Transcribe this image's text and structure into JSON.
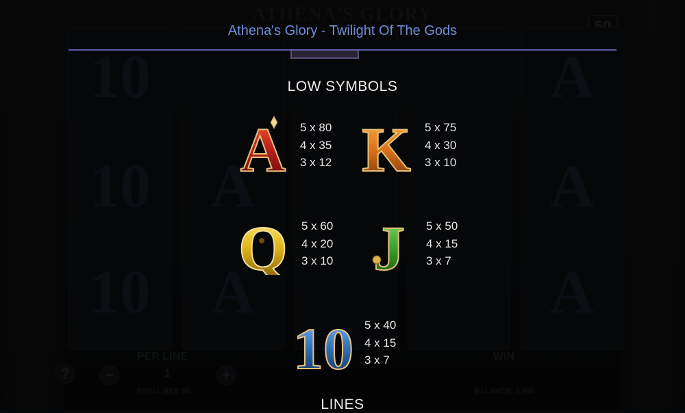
{
  "background": {
    "game_title": "ATHENA'S GLORY",
    "corner_value": "50",
    "per_line_label": "PER LINE",
    "per_line_value": "1",
    "win_label": "WIN",
    "total_bet_label": "TOTAL BET: 50",
    "balance_label": "BALANCE: 4,950",
    "help_symbol": "?",
    "minus_symbol": "−",
    "plus_symbol": "+",
    "reel_glyphs": [
      "10",
      "A",
      "A",
      "A",
      "A"
    ]
  },
  "paytable": {
    "title": "Athena's Glory - Twilight Of The Gods",
    "low_symbols_title": "LOW SYMBOLS",
    "next_section_title": "LINES",
    "symbols": [
      {
        "letter": "A",
        "icon": "ace-symbol-icon",
        "color": "#b51f1b",
        "payouts": [
          "5 x 80",
          "4 x 35",
          "3 x 12"
        ]
      },
      {
        "letter": "K",
        "icon": "king-symbol-icon",
        "color": "#d9731a",
        "payouts": [
          "5 x 75",
          "4 x 30",
          "3 x 10"
        ]
      },
      {
        "letter": "Q",
        "icon": "queen-symbol-icon",
        "color": "#e0b418",
        "payouts": [
          "5 x 60",
          "4 x 20",
          "3 x 10"
        ]
      },
      {
        "letter": "J",
        "icon": "jack-symbol-icon",
        "color": "#3aa12e",
        "payouts": [
          "5 x 50",
          "4 x 15",
          "3 x 7"
        ]
      },
      {
        "letter": "10",
        "icon": "ten-symbol-icon",
        "color": "#2f6fb8",
        "payouts": [
          "5 x 40",
          "4 x 15",
          "3 x 7"
        ]
      }
    ]
  }
}
